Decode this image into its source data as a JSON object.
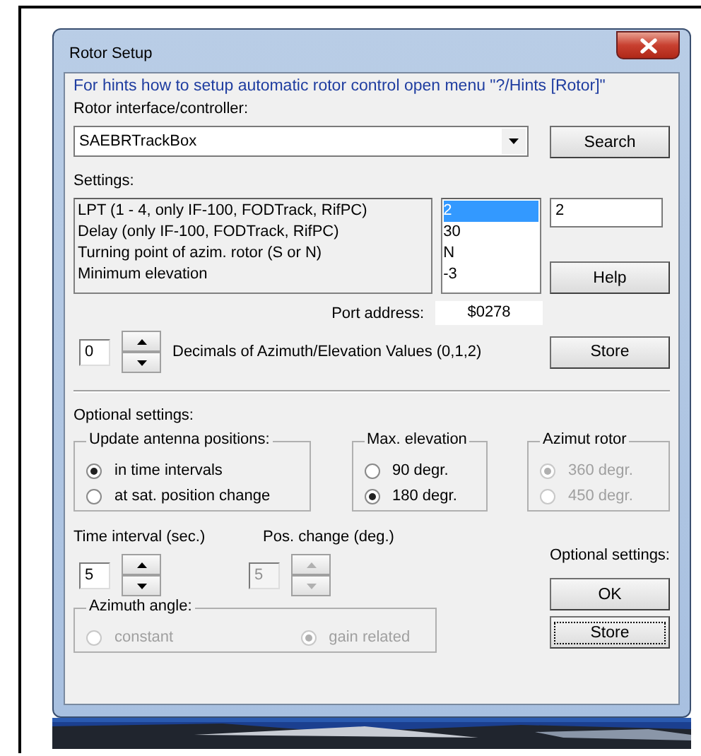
{
  "window": {
    "title": "Rotor Setup"
  },
  "hint": "For hints  how to setup automatic rotor control open menu \"?/Hints [Rotor]\"",
  "interface_label": "Rotor interface/controller:",
  "controller": {
    "value": "SAEBRTrackBox"
  },
  "search_button": "Search",
  "settings_label": "Settings:",
  "settings": [
    {
      "label": "LPT (1 - 4, only IF-100, FODTrack, RifPC)",
      "value": "2",
      "selected": true
    },
    {
      "label": "Delay  (only  IF-100, FODTrack, RifPC)",
      "value": "30",
      "selected": false
    },
    {
      "label": "Turning point of azim. rotor  (S or N)",
      "value": "N",
      "selected": false
    },
    {
      "label": "Minimum elevation",
      "value": "-3",
      "selected": false
    }
  ],
  "value_field": {
    "value": "2"
  },
  "help_button": "Help",
  "port_address_label": "Port  address:",
  "port_address": "$0278",
  "decimals": {
    "value": "0",
    "label": "Decimals of Azimuth/Elevation Values  (0,1,2)"
  },
  "store_button": "Store",
  "optional_label": "Optional settings:",
  "groups": [
    {
      "title": "Update antenna positions:",
      "disabled": false,
      "options": [
        {
          "label": "in time intervals",
          "selected": true
        },
        {
          "label": "at sat. position change",
          "selected": false
        }
      ]
    },
    {
      "title": "Max. elevation",
      "disabled": false,
      "options": [
        {
          "label": " 90  degr.",
          "selected": false
        },
        {
          "label": "180 degr.",
          "selected": true
        }
      ]
    },
    {
      "title": "Azimut rotor",
      "disabled": true,
      "options": [
        {
          "label": "360 degr.",
          "selected": true
        },
        {
          "label": "450 degr.",
          "selected": false
        }
      ]
    }
  ],
  "spinners": [
    {
      "label": "Time interval (sec.)",
      "value": "5",
      "disabled": false
    },
    {
      "label": "Pos. change (deg.)",
      "value": "5",
      "disabled": true
    }
  ],
  "azimuth_angle": {
    "title": "Azimuth angle:",
    "disabled": true,
    "options": [
      {
        "label": "constant",
        "selected": false
      },
      {
        "label": "gain related",
        "selected": true
      }
    ]
  },
  "optional_settings_label": "Optional settings:",
  "buttons": [
    {
      "label": "OK",
      "focused": false
    },
    {
      "label": "Store",
      "focused": true
    }
  ]
}
